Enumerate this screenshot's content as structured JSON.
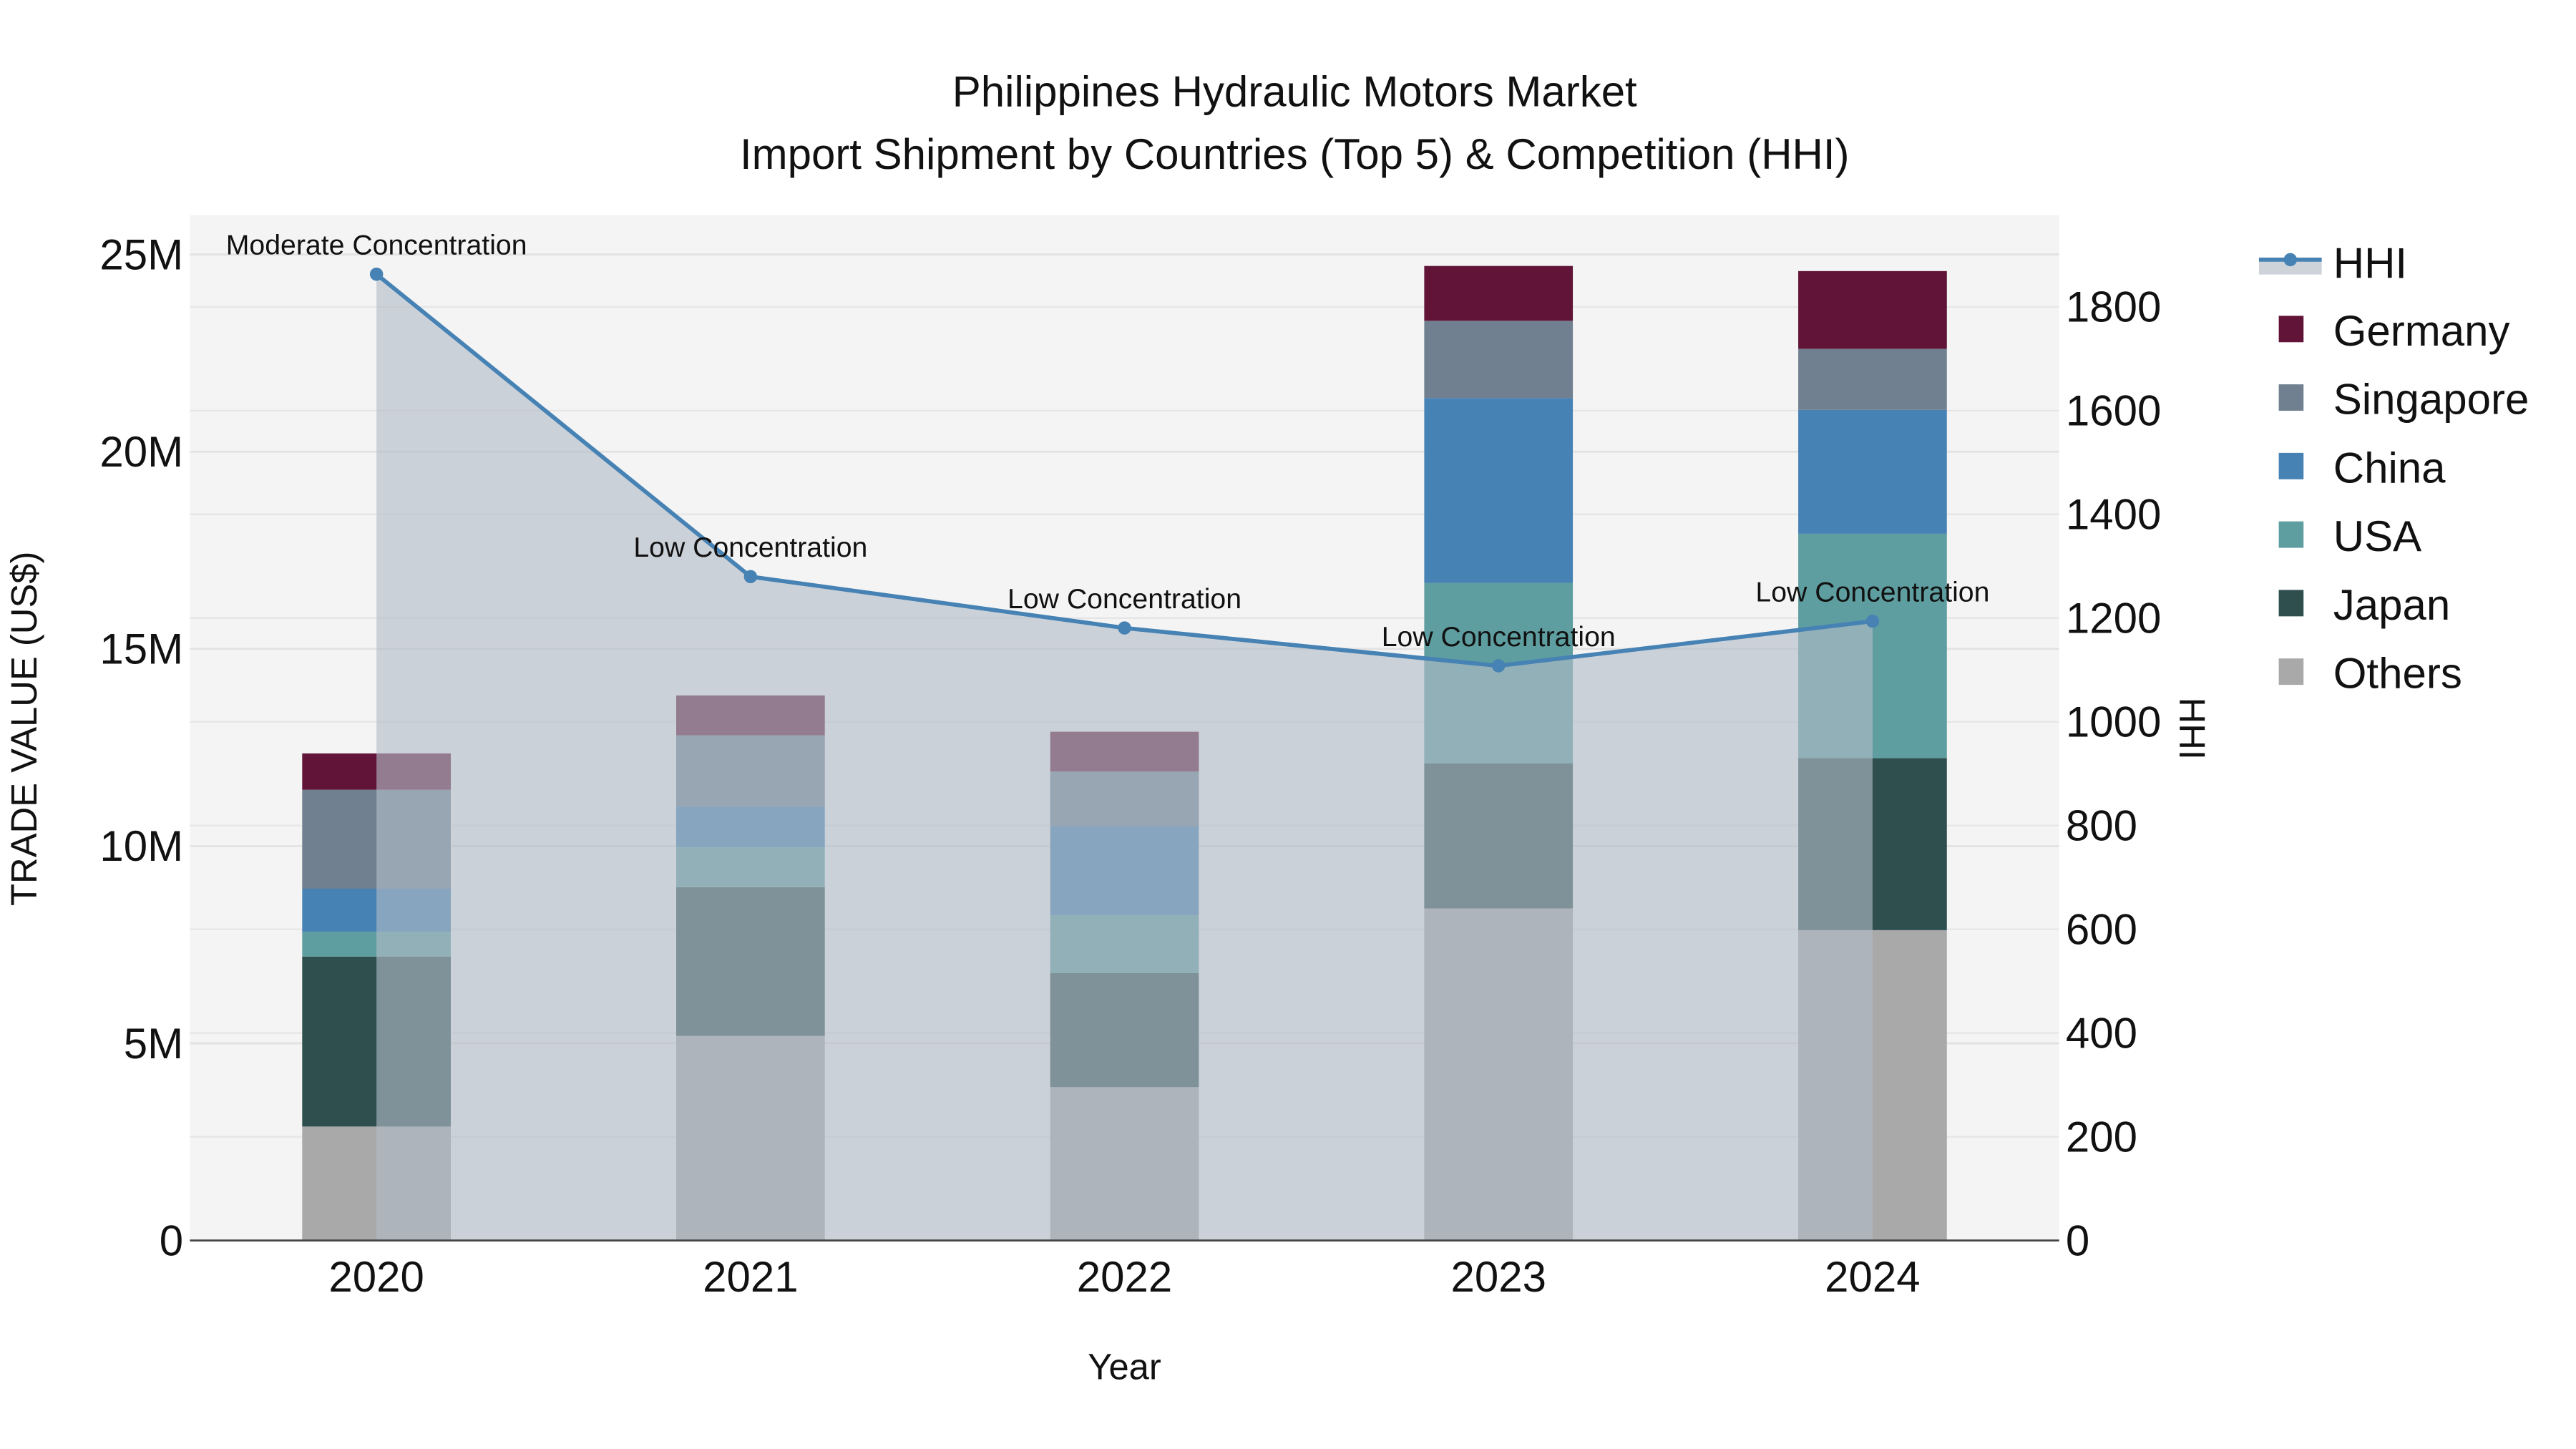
{
  "chart_data": {
    "type": "bar",
    "stacked": true,
    "title": "Philippines Hydraulic Motors Market",
    "subtitle": "Import Shipment by Countries (Top 5) & Competition (HHI)",
    "xlabel": "Year",
    "ylabel": "TRADE VALUE (US$)",
    "y2label": "HHI",
    "categories": [
      "2020",
      "2021",
      "2022",
      "2023",
      "2024"
    ],
    "ylim": [
      0,
      26000000
    ],
    "y2lim": [
      0,
      1977
    ],
    "yticks": [
      0,
      5000000,
      10000000,
      15000000,
      20000000,
      25000000
    ],
    "ytick_labels": [
      "0",
      "5M",
      "10M",
      "15M",
      "20M",
      "25M"
    ],
    "y2ticks": [
      0,
      200,
      400,
      600,
      800,
      1000,
      1200,
      1400,
      1600,
      1800
    ],
    "y2tick_labels": [
      "0",
      "200",
      "400",
      "600",
      "800",
      "1000",
      "1200",
      "1400",
      "1600",
      "1800"
    ],
    "grid": true,
    "legend_position": "right",
    "series": [
      {
        "name": "Others",
        "color": "#a9a9a9",
        "values": [
          2890000,
          5190000,
          3890000,
          8420000,
          7870000
        ]
      },
      {
        "name": "Japan",
        "color": "#2f4f4f",
        "values": [
          4310000,
          3770000,
          2890000,
          3680000,
          4360000
        ]
      },
      {
        "name": "USA",
        "color": "#5f9ea0",
        "values": [
          630000,
          1010000,
          1470000,
          4570000,
          5690000
        ]
      },
      {
        "name": "China",
        "color": "#4682b4",
        "values": [
          1090000,
          1040000,
          2260000,
          4690000,
          3140000
        ]
      },
      {
        "name": "Singapore",
        "color": "#708090",
        "values": [
          2510000,
          1800000,
          1380000,
          1960000,
          1550000
        ]
      },
      {
        "name": "Germany",
        "color": "#611437",
        "values": [
          920000,
          1010000,
          1010000,
          1390000,
          1970000
        ]
      }
    ],
    "hhi": {
      "name": "HHI",
      "color": "#4682b4",
      "values": [
        1863,
        1280,
        1181,
        1108,
        1194
      ],
      "annotations": [
        "Moderate Concentration",
        "Low Concentration",
        "Low Concentration",
        "Low Concentration",
        "Low Concentration"
      ]
    },
    "legend": [
      "HHI",
      "Germany",
      "Singapore",
      "China",
      "USA",
      "Japan",
      "Others"
    ]
  }
}
